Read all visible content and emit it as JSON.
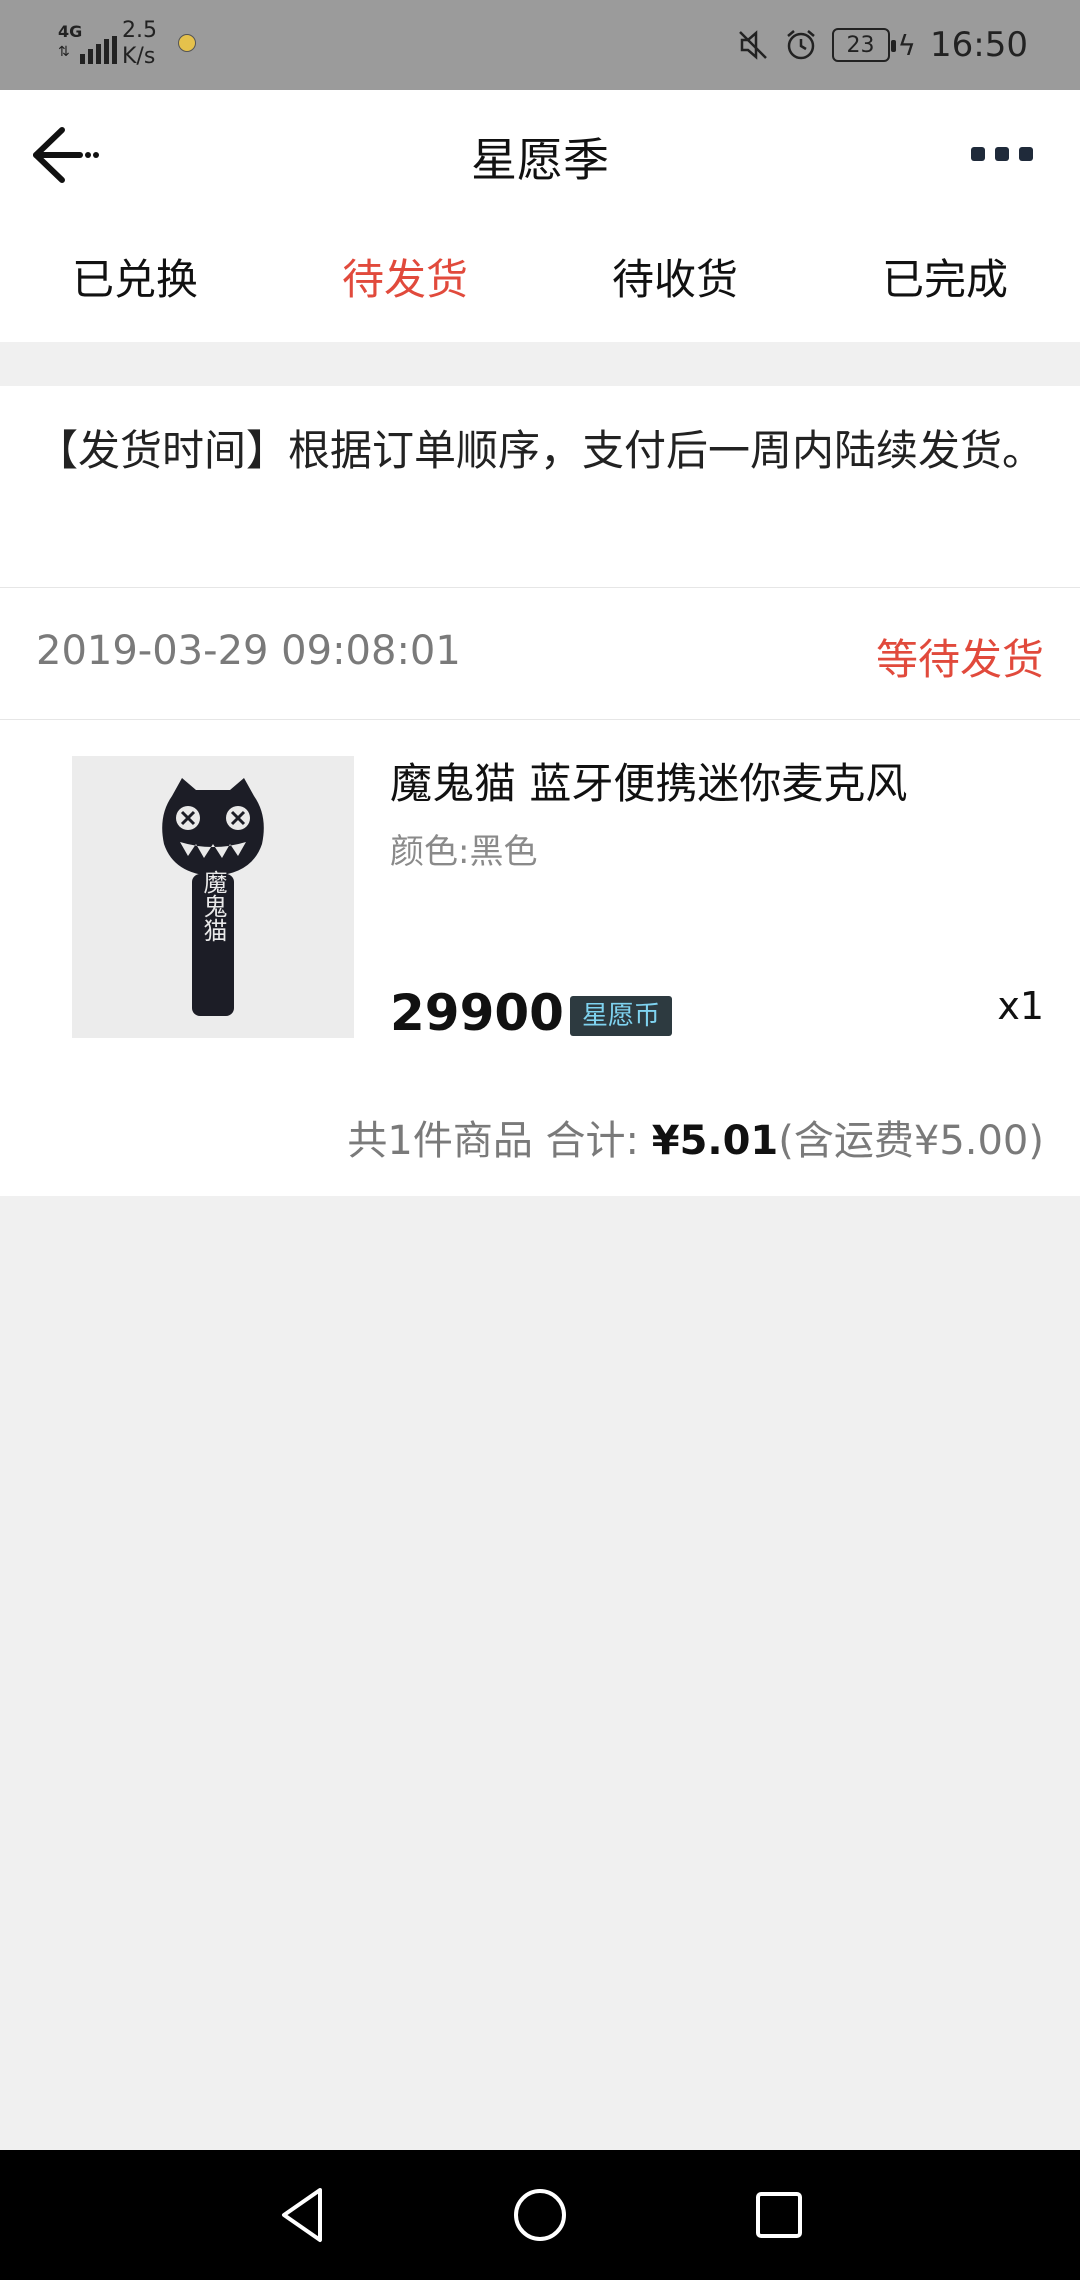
{
  "status_bar": {
    "network": "4G",
    "speed": "2.5",
    "speed_unit": "K/s",
    "battery": "23",
    "time": "16:50"
  },
  "header": {
    "title": "星愿季",
    "back_icon": "back-arrow-icon",
    "more_icon": "more-dots-icon"
  },
  "tabs": [
    {
      "label": "已兑换"
    },
    {
      "label": "待发货",
      "active": true
    },
    {
      "label": "待收货"
    },
    {
      "label": "已完成"
    }
  ],
  "notice": {
    "text": "【发货时间】根据订单顺序，支付后一周内陆续发货。"
  },
  "order": {
    "timestamp": "2019-03-29 09:08:01",
    "status": "等待发货",
    "product": {
      "name": "魔鬼猫 蓝牙便携迷你麦克风",
      "variant": "颜色:黑色",
      "price": "29900",
      "currency_badge": "星愿币",
      "quantity": "x1",
      "image_text": "魔鬼猫"
    },
    "summary": {
      "count_text": "共1件商品 合计: ",
      "amount": "¥5.01",
      "shipping": "(含运费¥5.00)"
    }
  },
  "colors": {
    "accent": "#e14a3c",
    "status_bar_bg": "#9b9b9b",
    "page_bg": "#f0f0f0"
  }
}
